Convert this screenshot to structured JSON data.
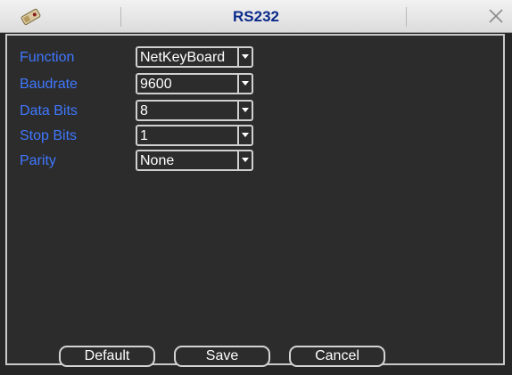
{
  "window": {
    "title": "RS232"
  },
  "icons": {
    "app": "hdd-tool-icon",
    "close": "close-icon"
  },
  "fields": [
    {
      "label": "Function",
      "value": "NetKeyBoard"
    },
    {
      "label": "Baudrate",
      "value": "9600"
    },
    {
      "label": "Data Bits",
      "value": "8"
    },
    {
      "label": "Stop Bits",
      "value": "1"
    },
    {
      "label": "Parity",
      "value": "None"
    }
  ],
  "buttons": {
    "default_label": "Default",
    "save_label": "Save",
    "cancel_label": "Cancel"
  },
  "colors": {
    "label": "#3f78ff",
    "title": "#0b2a8a",
    "background": "#2c2c2c"
  }
}
